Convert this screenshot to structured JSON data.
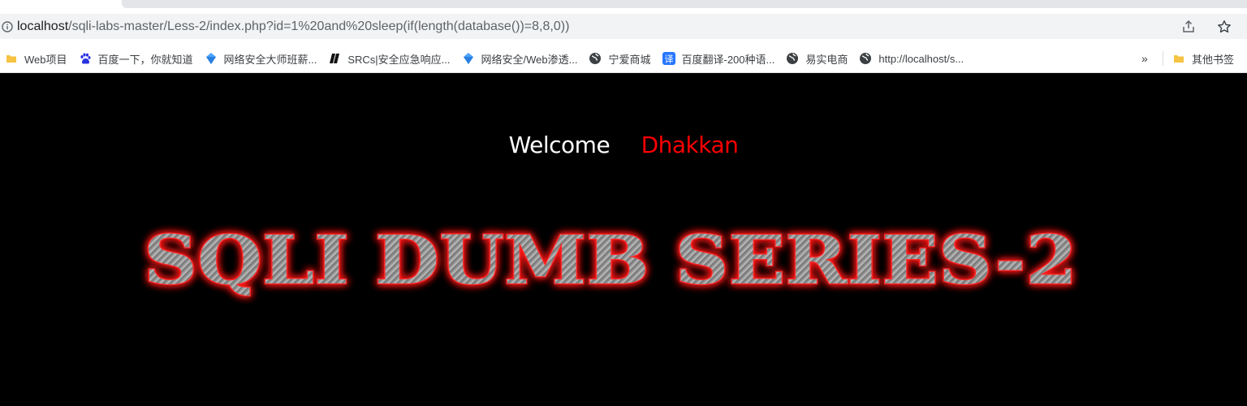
{
  "browser": {
    "url_host": "localhost",
    "url_path": "/sqli-labs-master/Less-2/index.php?id=1%20and%20sleep(if(length(database())=8,8,0))",
    "bookmarks": [
      {
        "label": "Web项目",
        "icon": "folder-icon",
        "color": "#f6c343"
      },
      {
        "label": "百度一下，你就知道",
        "icon": "baidu-paw-icon",
        "color": "#2932e1"
      },
      {
        "label": "网络安全大师班薪...",
        "icon": "diamond-logo-icon",
        "color": "#4da3ff"
      },
      {
        "label": "SRCs|安全应急响应...",
        "icon": "srcs-logo-icon",
        "color": "#111111"
      },
      {
        "label": "网络安全/Web渗透...",
        "icon": "diamond-logo-icon",
        "color": "#4da3ff"
      },
      {
        "label": "宁爱商城",
        "icon": "globe-icon",
        "color": "#5f6368"
      },
      {
        "label": "百度翻译-200种语...",
        "icon": "translate-icon",
        "color": "#2878ff",
        "glyph": "译"
      },
      {
        "label": "易实电商",
        "icon": "globe-icon",
        "color": "#5f6368"
      },
      {
        "label": "http://localhost/s...",
        "icon": "globe-icon",
        "color": "#5f6368"
      }
    ],
    "more_label": "»",
    "other_bookmarks_label": "其他书签"
  },
  "page": {
    "welcome_label": "Welcome",
    "user_name": "Dhakkan",
    "banner_text": "SQLI DUMB SERIES-2",
    "colors": {
      "background": "#000000",
      "welcome": "#ffffff",
      "name": "#ff0000",
      "banner_glow": "#ff1a1a",
      "banner_fill": "#9a9a9a"
    }
  }
}
